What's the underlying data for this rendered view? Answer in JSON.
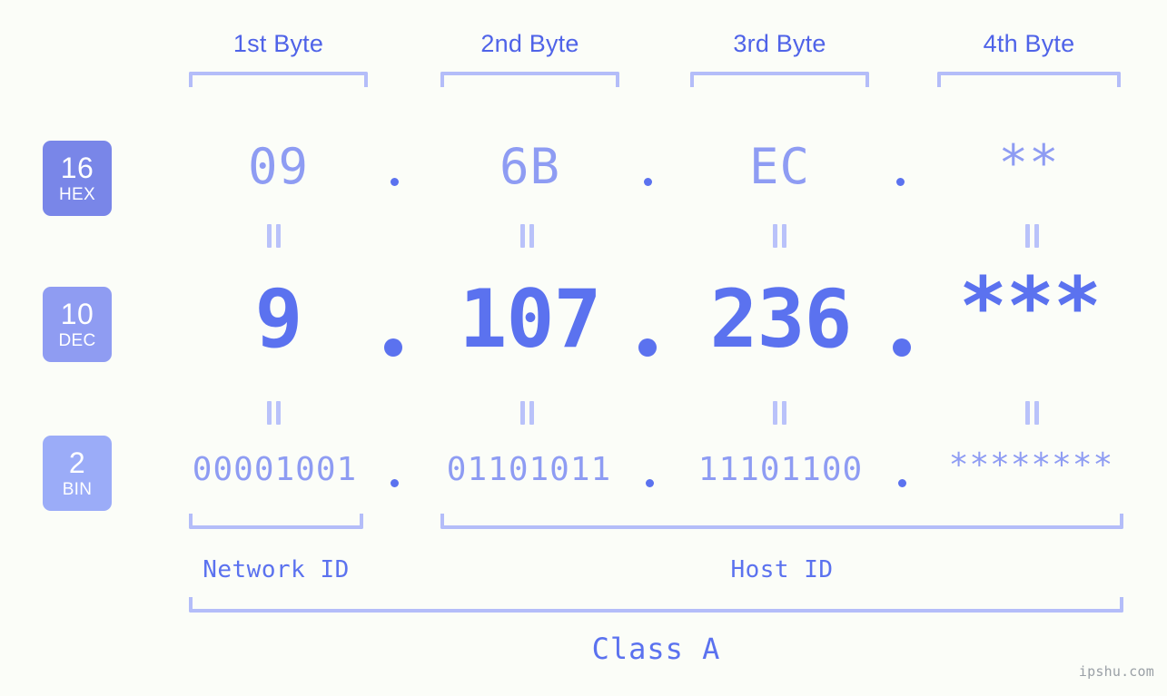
{
  "watermark": "ipshu.com",
  "colors": {
    "background": "#fbfdf8",
    "header_blue": "#4f63e8",
    "bracket": "#b4bdf9",
    "light_value": "#8e9cf3",
    "dec_value": "#5b72ef",
    "badge_hex": "#7986e8",
    "badge_dec": "#8f9cf2",
    "badge_bin": "#9bacf8",
    "equals": "#b9c2fa",
    "watermark": "#9aa0a6"
  },
  "byte_headers": [
    {
      "label": "1st Byte"
    },
    {
      "label": "2nd Byte"
    },
    {
      "label": "3rd Byte"
    },
    {
      "label": "4th Byte"
    }
  ],
  "bases": [
    {
      "num": "16",
      "abbr": "HEX"
    },
    {
      "num": "10",
      "abbr": "DEC"
    },
    {
      "num": "2",
      "abbr": "BIN"
    }
  ],
  "rows": {
    "hex": {
      "base_num": "16",
      "base_abbr": "HEX",
      "octets": [
        "09",
        "6B",
        "EC",
        "**"
      ],
      "separator": "."
    },
    "dec": {
      "base_num": "10",
      "base_abbr": "DEC",
      "octets": [
        "9",
        "107",
        "236",
        "***"
      ],
      "separator": "."
    },
    "bin": {
      "base_num": "2",
      "base_abbr": "BIN",
      "octets": [
        "00001001",
        "01101011",
        "11101100",
        "********"
      ],
      "separator": "."
    }
  },
  "equals_symbol": "=",
  "footer": {
    "network_id": "Network ID",
    "host_id": "Host ID",
    "class_label": "Class A"
  }
}
